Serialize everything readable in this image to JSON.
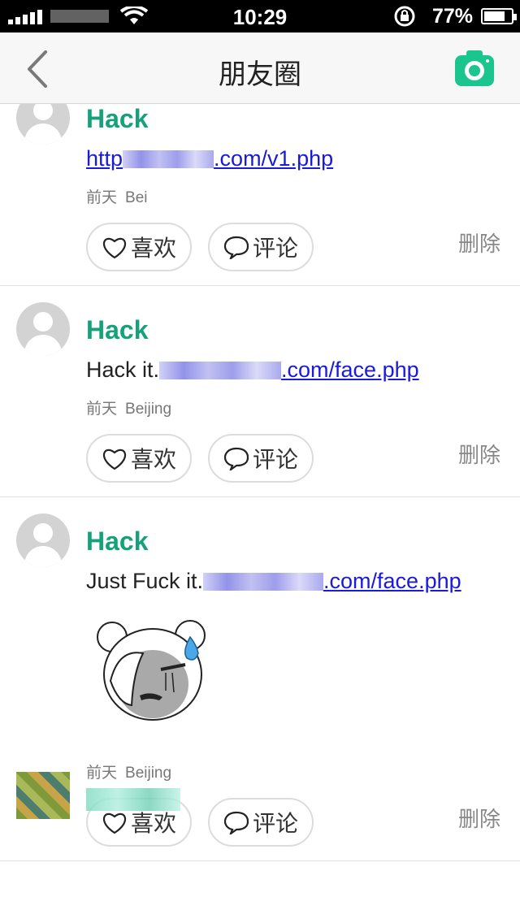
{
  "status_bar": {
    "time": "10:29",
    "battery_percent": "77%",
    "battery_level": 0.77
  },
  "nav": {
    "title": "朋友圈"
  },
  "posts": [
    {
      "author": "Hack",
      "text_prefix": "",
      "link_start": "http",
      "link_end": ".com/v1.php",
      "time": "前天",
      "location": "Bei",
      "like_label": "喜欢",
      "comment_label": "评论",
      "delete_label": "删除"
    },
    {
      "author": "Hack",
      "text_prefix": "Hack it.",
      "link_start": "",
      "link_end": ".com/face.php",
      "time": "前天",
      "location": "Beijing",
      "like_label": "喜欢",
      "comment_label": "评论",
      "delete_label": "删除"
    },
    {
      "author": "Hack",
      "text_prefix": "Just Fuck it.",
      "link_start": "",
      "link_end": ".com/face.php",
      "time": "前天",
      "location": "Beijing",
      "like_label": "喜欢",
      "comment_label": "评论",
      "delete_label": "删除"
    }
  ],
  "colors": {
    "accent": "#15a27a",
    "link": "#1a1ad9",
    "camera": "#1bc58e"
  },
  "icons": [
    "back-chevron-icon",
    "camera-icon",
    "heart-icon",
    "comment-bubble-icon",
    "wifi-icon",
    "rotation-lock-icon",
    "battery-icon"
  ]
}
